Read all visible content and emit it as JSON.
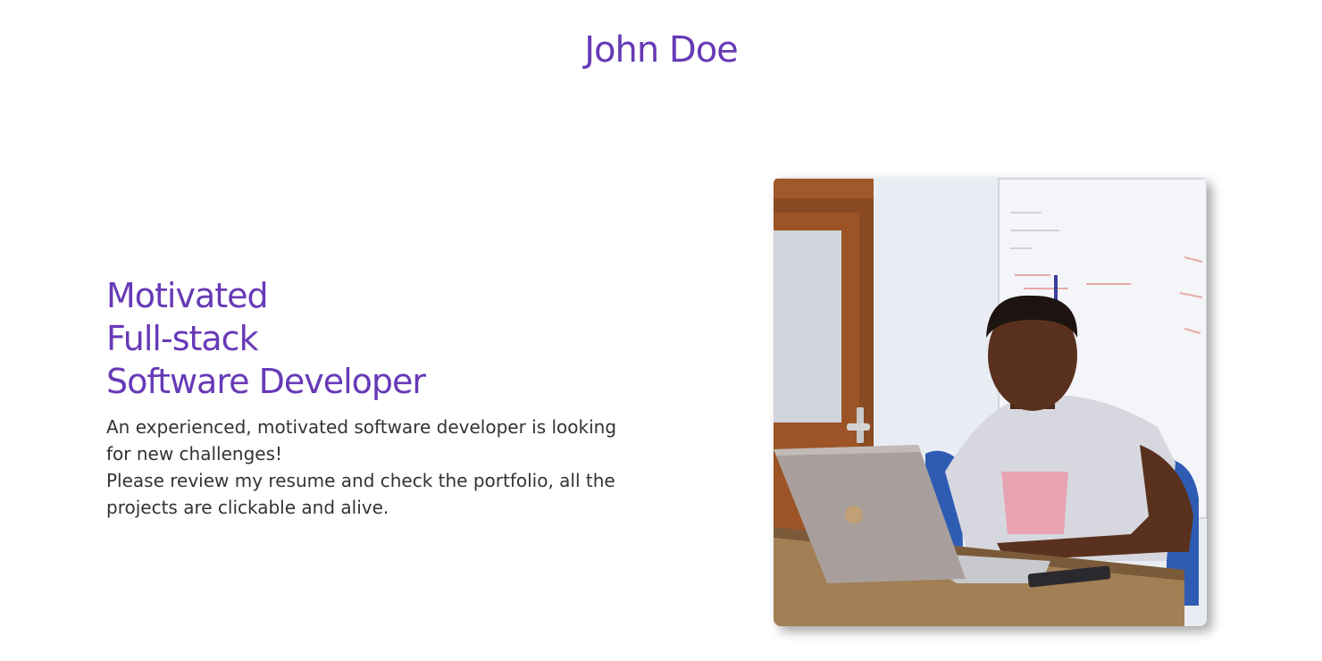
{
  "header": {
    "title": "John Doe"
  },
  "hero": {
    "heading_lines": [
      "Motivated",
      "Full-stack",
      "Software Developer"
    ],
    "description_lines": [
      "An experienced, motivated software developer is looking for new challenges!",
      "Please review my resume and check the portfolio, all the projects are clickable and alive."
    ]
  },
  "colors": {
    "accent": "#673ab7",
    "body_text": "#333333",
    "background": "#ffffff"
  }
}
